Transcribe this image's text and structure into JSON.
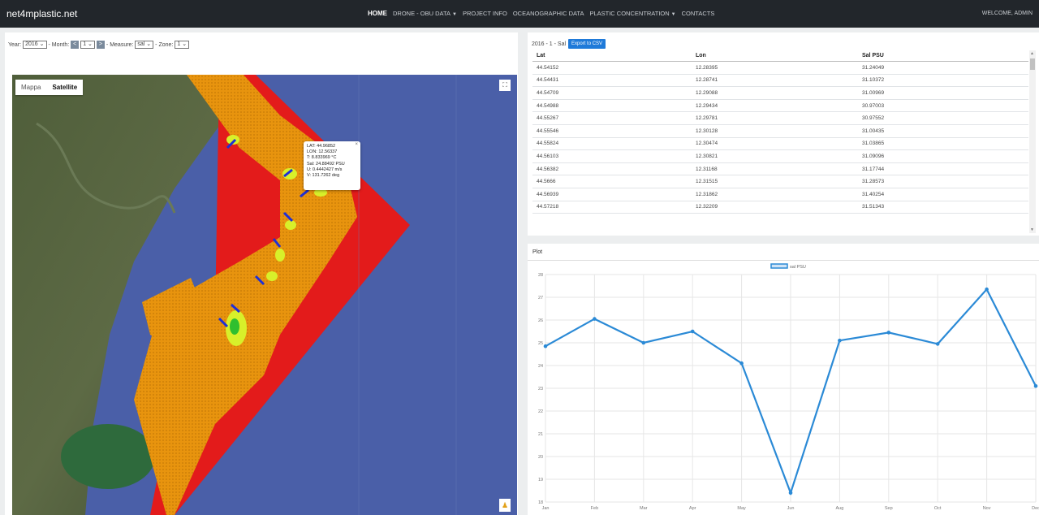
{
  "navbar": {
    "brand": "net4mplastic.net",
    "links": [
      {
        "label": "HOME",
        "active": true,
        "dropdown": false
      },
      {
        "label": "DRONE - OBU DATA",
        "active": false,
        "dropdown": true
      },
      {
        "label": "PROJECT INFO",
        "active": false,
        "dropdown": false
      },
      {
        "label": "OCEANOGRAPHIC DATA",
        "active": false,
        "dropdown": false
      },
      {
        "label": "PLASTIC CONCENTRATION",
        "active": false,
        "dropdown": true
      },
      {
        "label": "CONTACTS",
        "active": false,
        "dropdown": false
      }
    ],
    "welcome": "WELCOME, ADMIN"
  },
  "controls": {
    "year_label": "Year:",
    "year_value": "2016",
    "month_label": "- Month:",
    "month_dec": "<",
    "month_value": "1",
    "month_inc": ">",
    "measure_label": "- Measure:",
    "measure_value": "sal",
    "zone_label": "- Zone:",
    "zone_value": "1"
  },
  "map": {
    "type_map": "Mappa",
    "type_satellite": "Satellite",
    "fullscreen_icon": "fullscreen-icon",
    "pegman_icon": "pegman-icon",
    "infowindow": {
      "lines": [
        "LAT: 44.96852",
        "LON: 12.56337",
        "T: 8.833969 °C",
        "Sal: 24.88492 PSU",
        "U: 0.4442427 m/s",
        "V: 131.7262 deg"
      ],
      "close": "×"
    },
    "colors": {
      "sea": "#4a5fa8",
      "red_zone": "#e31b1b",
      "orange_zone": "#e8940e",
      "yellow_zone": "#d8f02a",
      "green_zone": "#2fbf2f",
      "markers": "#1e2fd6"
    }
  },
  "table": {
    "title": "2016 - 1 - Sal",
    "export_label": "Export to CSV",
    "headers": [
      "Lat",
      "Lon",
      "Sal PSU"
    ],
    "rows": [
      [
        "44.54152",
        "12.28395",
        "31.24049"
      ],
      [
        "44.54431",
        "12.28741",
        "31.10372"
      ],
      [
        "44.54709",
        "12.29088",
        "31.00969"
      ],
      [
        "44.54988",
        "12.29434",
        "30.97003"
      ],
      [
        "44.55267",
        "12.29781",
        "30.97552"
      ],
      [
        "44.55546",
        "12.30128",
        "31.00435"
      ],
      [
        "44.55824",
        "12.30474",
        "31.03865"
      ],
      [
        "44.56103",
        "12.30821",
        "31.09096"
      ],
      [
        "44.56382",
        "12.31168",
        "31.17744"
      ],
      [
        "44.5666",
        "12.31515",
        "31.28573"
      ],
      [
        "44.56939",
        "12.31862",
        "31.40254"
      ],
      [
        "44.57218",
        "12.32209",
        "31.51343"
      ]
    ]
  },
  "plot": {
    "title": "Plot"
  },
  "chart_data": {
    "type": "line",
    "categories": [
      "Jan",
      "Feb",
      "Mar",
      "Apr",
      "May",
      "Jun",
      "Aug",
      "Sep",
      "Oct",
      "Nov",
      "Dec"
    ],
    "series": [
      {
        "name": "sal PSU",
        "values": [
          24.85,
          26.05,
          25.0,
          25.5,
          24.1,
          18.4,
          25.1,
          25.45,
          24.95,
          27.35,
          23.1
        ],
        "color": "#2b8ad6"
      }
    ],
    "yticks": [
      "18",
      "19",
      "20",
      "21",
      "22",
      "23",
      "24",
      "25",
      "26",
      "27",
      "28"
    ],
    "ylim": [
      18,
      28
    ],
    "grid": true,
    "legend": "top-center"
  }
}
